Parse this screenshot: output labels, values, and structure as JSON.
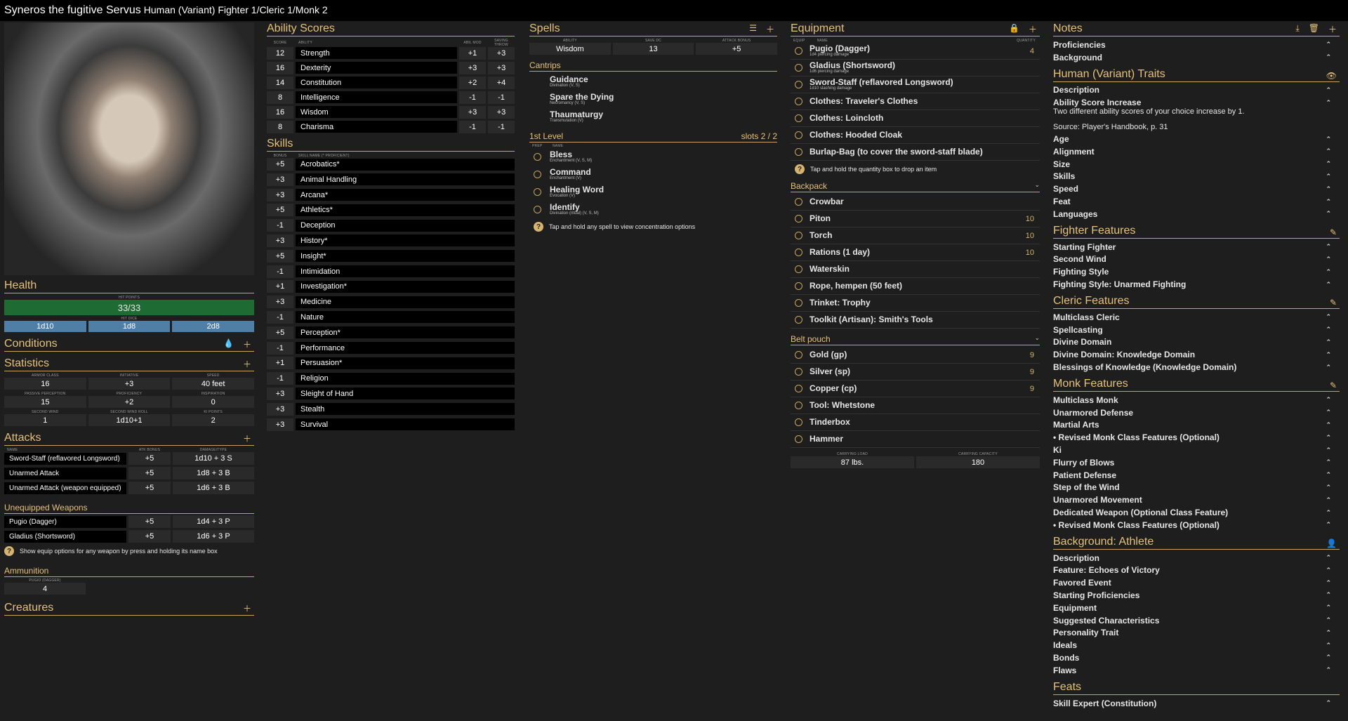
{
  "title": {
    "name": "Syneros the fugitive Servus",
    "subtitle": "Human (Variant) Fighter 1/Cleric 1/Monk 2"
  },
  "health": {
    "title": "Health",
    "hp_caption": "HIT POINTS",
    "hp": "33/33",
    "dice_caption": "HIT DICE",
    "dice": [
      "1d10",
      "1d8",
      "2d8"
    ]
  },
  "conditions": {
    "title": "Conditions"
  },
  "statistics": {
    "title": "Statistics",
    "rows": [
      [
        {
          "label": "ARMOR CLASS",
          "value": "16"
        },
        {
          "label": "INITIATIVE",
          "value": "+3"
        },
        {
          "label": "SPEED",
          "value": "40 feet"
        }
      ],
      [
        {
          "label": "PASSIVE PERCEPTION",
          "value": "15"
        },
        {
          "label": "PROFICIENCY",
          "value": "+2"
        },
        {
          "label": "INSPIRATION",
          "value": "0"
        }
      ],
      [
        {
          "label": "SECOND WIND",
          "value": "1"
        },
        {
          "label": "SECOND WIND ROLL",
          "value": "1d10+1"
        },
        {
          "label": "KI POINTS",
          "value": "2"
        }
      ]
    ]
  },
  "attacks": {
    "title": "Attacks",
    "headers": [
      "NAME",
      "ATK BONUS",
      "DAMAGE/TYPE"
    ],
    "rows": [
      {
        "name": "Sword-Staff (reflavored Longsword)",
        "bonus": "+5",
        "damage": "1d10 + 3 S"
      },
      {
        "name": "Unarmed Attack",
        "bonus": "+5",
        "damage": "1d8 + 3 B"
      },
      {
        "name": "Unarmed Attack (weapon equipped)",
        "bonus": "+5",
        "damage": "1d6 + 3 B"
      }
    ],
    "unequipped_title": "Unequipped Weapons",
    "unequipped": [
      {
        "name": "Pugio (Dagger)",
        "bonus": "+5",
        "damage": "1d4 + 3 P"
      },
      {
        "name": "Gladius (Shortsword)",
        "bonus": "+5",
        "damage": "1d6 + 3 P"
      }
    ],
    "hint": "Show equip options for any weapon by press and holding its name box",
    "ammo_title": "Ammunition",
    "ammo_caption": "PUGIO (DAGGER)",
    "ammo_value": "4"
  },
  "creatures": {
    "title": "Creatures"
  },
  "abilities": {
    "title": "Ability Scores",
    "headers": [
      "SCORE",
      "ABILITY",
      "ABIL MOD",
      "SAVING THROW"
    ],
    "rows": [
      {
        "score": "12",
        "name": "Strength",
        "mod": "+1",
        "save": "+3"
      },
      {
        "score": "16",
        "name": "Dexterity",
        "mod": "+3",
        "save": "+3"
      },
      {
        "score": "14",
        "name": "Constitution",
        "mod": "+2",
        "save": "+4"
      },
      {
        "score": "8",
        "name": "Intelligence",
        "mod": "-1",
        "save": "-1"
      },
      {
        "score": "16",
        "name": "Wisdom",
        "mod": "+3",
        "save": "+3"
      },
      {
        "score": "8",
        "name": "Charisma",
        "mod": "-1",
        "save": "-1"
      }
    ]
  },
  "skills": {
    "title": "Skills",
    "headers": [
      "BONUS",
      "SKILL NAME (* PROFICIENT)"
    ],
    "rows": [
      {
        "bonus": "+5",
        "name": "Acrobatics*"
      },
      {
        "bonus": "+3",
        "name": "Animal Handling"
      },
      {
        "bonus": "+3",
        "name": "Arcana*"
      },
      {
        "bonus": "+5",
        "name": "Athletics*"
      },
      {
        "bonus": "-1",
        "name": "Deception"
      },
      {
        "bonus": "+3",
        "name": "History*"
      },
      {
        "bonus": "+5",
        "name": "Insight*"
      },
      {
        "bonus": "-1",
        "name": "Intimidation"
      },
      {
        "bonus": "+1",
        "name": "Investigation*"
      },
      {
        "bonus": "+3",
        "name": "Medicine"
      },
      {
        "bonus": "-1",
        "name": "Nature"
      },
      {
        "bonus": "+5",
        "name": "Perception*"
      },
      {
        "bonus": "-1",
        "name": "Performance"
      },
      {
        "bonus": "+1",
        "name": "Persuasion*"
      },
      {
        "bonus": "-1",
        "name": "Religion"
      },
      {
        "bonus": "+3",
        "name": "Sleight of Hand"
      },
      {
        "bonus": "+3",
        "name": "Stealth"
      },
      {
        "bonus": "+3",
        "name": "Survival"
      }
    ]
  },
  "spells": {
    "title": "Spells",
    "headers": [
      "ABILITY",
      "SAVE DC",
      "ATTACK BONUS"
    ],
    "ability": "Wisdom",
    "dc": "13",
    "attack": "+5",
    "cantrips_title": "Cantrips",
    "cantrips": [
      {
        "name": "Guidance",
        "desc": "Divination (V, S)"
      },
      {
        "name": "Spare the Dying",
        "desc": "Necromancy (V, S)"
      },
      {
        "name": "Thaumaturgy",
        "desc": "Transmutation (V)"
      }
    ],
    "level1_title": "1st Level",
    "level1_slots": "slots 2 / 2",
    "level1_headers": [
      "PREP",
      "NAME"
    ],
    "level1": [
      {
        "name": "Bless",
        "desc": "Enchantment (V, S, M)"
      },
      {
        "name": "Command",
        "desc": "Enchantment (V)"
      },
      {
        "name": "Healing Word",
        "desc": "Evocation (V)"
      },
      {
        "name": "Identify",
        "desc": "Divination (ritual) (V, S, M)"
      }
    ],
    "hint": "Tap and hold any spell to view concentration options"
  },
  "equipment": {
    "title": "Equipment",
    "headers": [
      "EQUIP",
      "NAME",
      "QUANTITY"
    ],
    "items": [
      {
        "name": "Pugio (Dagger)",
        "desc": "1d4 piercing damage",
        "qty": "4"
      },
      {
        "name": "Gladius (Shortsword)",
        "desc": "1d6 piercing damage",
        "qty": ""
      },
      {
        "name": "Sword-Staff (reflavored Longsword)",
        "desc": "1d10 slashing damage",
        "qty": ""
      },
      {
        "name": "Clothes: Traveler's Clothes",
        "desc": "",
        "qty": ""
      },
      {
        "name": "Clothes: Loincloth",
        "desc": "",
        "qty": ""
      },
      {
        "name": "Clothes: Hooded Cloak",
        "desc": "",
        "qty": ""
      },
      {
        "name": "Burlap-Bag (to cover the sword-staff blade)",
        "desc": "",
        "qty": ""
      }
    ],
    "hint": "Tap and hold the quantity box to drop an item",
    "backpack_title": "Backpack",
    "backpack": [
      {
        "name": "Crowbar",
        "qty": ""
      },
      {
        "name": "Piton",
        "qty": "10"
      },
      {
        "name": "Torch",
        "qty": "10"
      },
      {
        "name": "Rations (1 day)",
        "qty": "10"
      },
      {
        "name": "Waterskin",
        "qty": ""
      },
      {
        "name": "Rope, hempen (50 feet)",
        "qty": ""
      },
      {
        "name": "Trinket: Trophy",
        "qty": ""
      },
      {
        "name": "Toolkit (Artisan): Smith's Tools",
        "qty": ""
      }
    ],
    "belt_title": "Belt pouch",
    "belt": [
      {
        "name": "Gold (gp)",
        "qty": "9"
      },
      {
        "name": "Silver (sp)",
        "qty": "9"
      },
      {
        "name": "Copper (cp)",
        "qty": "9"
      },
      {
        "name": "Tool: Whetstone",
        "qty": ""
      },
      {
        "name": "Tinderbox",
        "qty": ""
      },
      {
        "name": "Hammer",
        "qty": ""
      }
    ],
    "load_caption": "CARRYING LOAD",
    "load": "87 lbs.",
    "capacity_caption": "CARRYING CAPACITY",
    "capacity": "180"
  },
  "notes": {
    "title": "Notes",
    "items": [
      "Proficiencies",
      "Background"
    ],
    "sections": [
      {
        "title": "Human (Variant) Traits",
        "items": [
          "Description",
          "Ability Score Increase"
        ],
        "detail": "Two different ability scores of your choice increase by 1.",
        "source": "Source: Player's Handbook, p. 31",
        "items2": [
          "Age",
          "Alignment",
          "Size",
          "Skills",
          "Speed",
          "Feat",
          "Languages"
        ]
      },
      {
        "title": "Fighter Features",
        "items": [
          "Starting Fighter",
          "Second Wind",
          "Fighting Style",
          "Fighting Style: Unarmed Fighting"
        ]
      },
      {
        "title": "Cleric Features",
        "items": [
          "Multiclass Cleric",
          "Spellcasting",
          "Divine Domain",
          "Divine Domain: Knowledge Domain",
          "Blessings of Knowledge (Knowledge Domain)"
        ]
      },
      {
        "title": "Monk Features",
        "items": [
          "Multiclass Monk",
          "Unarmored Defense",
          "Martial Arts",
          "• Revised Monk Class Features (Optional)",
          "Ki",
          "Flurry of Blows",
          "Patient Defense",
          "Step of the Wind",
          "Unarmored Movement",
          "Dedicated Weapon (Optional Class Feature)",
          "• Revised Monk Class Features (Optional)"
        ]
      },
      {
        "title": "Background: Athlete",
        "items": [
          "Description",
          "Feature: Echoes of Victory",
          "Favored Event",
          "Starting Proficiencies",
          "Equipment",
          "Suggested Characteristics",
          "Personality Trait",
          "Ideals",
          "Bonds",
          "Flaws"
        ]
      },
      {
        "title": "Feats",
        "items": [
          "Skill Expert (Constitution)"
        ]
      }
    ]
  },
  "colors": {
    "accent": "#e5c17c",
    "health": "#1f6b34",
    "dice": "#4f7fa6",
    "background": "#1e1e1e"
  }
}
